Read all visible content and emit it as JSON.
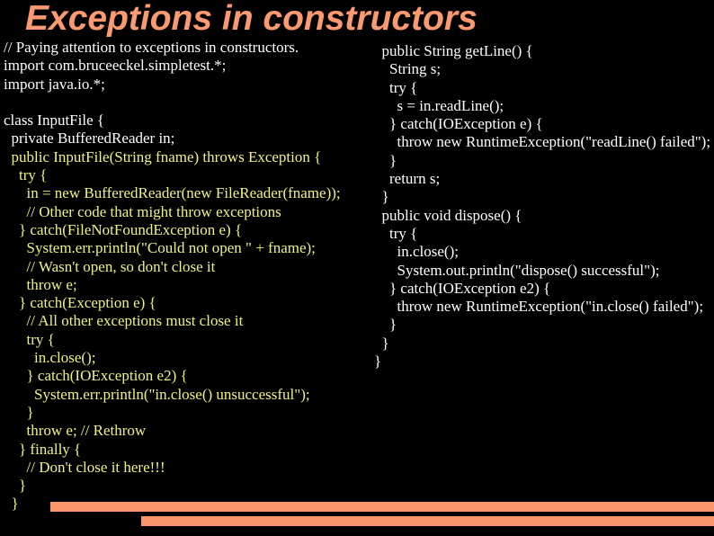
{
  "slide": {
    "title": "Exceptions in constructors",
    "background_color": "#000000",
    "accent_color": "#FB9A70",
    "code_white_color": "#FFFFFF",
    "code_yellow_color": "#F2F27E"
  },
  "code_left": {
    "lines": [
      {
        "text": "// Paying attention to exceptions in constructors.",
        "color": "white"
      },
      {
        "text": "import com.bruceeckel.simpletest.*;",
        "color": "white"
      },
      {
        "text": "import java.io.*;",
        "color": "white"
      },
      {
        "text": "",
        "color": "white"
      },
      {
        "text": "class InputFile {",
        "color": "white"
      },
      {
        "text": "  private BufferedReader in;",
        "color": "white"
      },
      {
        "text": "  public InputFile(String fname) throws Exception {",
        "color": "yellow"
      },
      {
        "text": "    try {",
        "color": "yellow"
      },
      {
        "text": "      in = new BufferedReader(new FileReader(fname));",
        "color": "yellow"
      },
      {
        "text": "      // Other code that might throw exceptions",
        "color": "yellow"
      },
      {
        "text": "    } catch(FileNotFoundException e) {",
        "color": "yellow"
      },
      {
        "text": "      System.err.println(\"Could not open \" + fname);",
        "color": "yellow"
      },
      {
        "text": "      // Wasn't open, so don't close it",
        "color": "yellow"
      },
      {
        "text": "      throw e;",
        "color": "yellow"
      },
      {
        "text": "    } catch(Exception e) {",
        "color": "yellow"
      },
      {
        "text": "      // All other exceptions must close it",
        "color": "yellow"
      },
      {
        "text": "      try {",
        "color": "yellow"
      },
      {
        "text": "        in.close();",
        "color": "yellow"
      },
      {
        "text": "      } catch(IOException e2) {",
        "color": "yellow"
      },
      {
        "text": "        System.err.println(\"in.close() unsuccessful\");",
        "color": "yellow"
      },
      {
        "text": "      }",
        "color": "yellow"
      },
      {
        "text": "      throw e; // Rethrow",
        "color": "yellow"
      },
      {
        "text": "    } finally {",
        "color": "yellow"
      },
      {
        "text": "      // Don't close it here!!!",
        "color": "yellow"
      },
      {
        "text": "    }",
        "color": "yellow"
      },
      {
        "text": "  }",
        "color": "yellow"
      }
    ]
  },
  "code_right": {
    "lines": [
      {
        "text": "  public String getLine() {",
        "color": "white"
      },
      {
        "text": "    String s;",
        "color": "white"
      },
      {
        "text": "    try {",
        "color": "white"
      },
      {
        "text": "      s = in.readLine();",
        "color": "white"
      },
      {
        "text": "    } catch(IOException e) {",
        "color": "white"
      },
      {
        "text": "      throw new RuntimeException(\"readLine() failed\");",
        "color": "white"
      },
      {
        "text": "    }",
        "color": "white"
      },
      {
        "text": "    return s;",
        "color": "white"
      },
      {
        "text": "  }",
        "color": "white"
      },
      {
        "text": "  public void dispose() {",
        "color": "white"
      },
      {
        "text": "    try {",
        "color": "white"
      },
      {
        "text": "      in.close();",
        "color": "white"
      },
      {
        "text": "      System.out.println(\"dispose() successful\");",
        "color": "white"
      },
      {
        "text": "    } catch(IOException e2) {",
        "color": "white"
      },
      {
        "text": "      throw new RuntimeException(\"in.close() failed\");",
        "color": "white"
      },
      {
        "text": "    }",
        "color": "white"
      },
      {
        "text": "  }",
        "color": "white"
      },
      {
        "text": "}",
        "color": "white"
      }
    ]
  },
  "decorations": {
    "bar_color": "#FC9569",
    "bars": [
      {
        "name": "upper-bar"
      },
      {
        "name": "lower-bar"
      }
    ]
  }
}
